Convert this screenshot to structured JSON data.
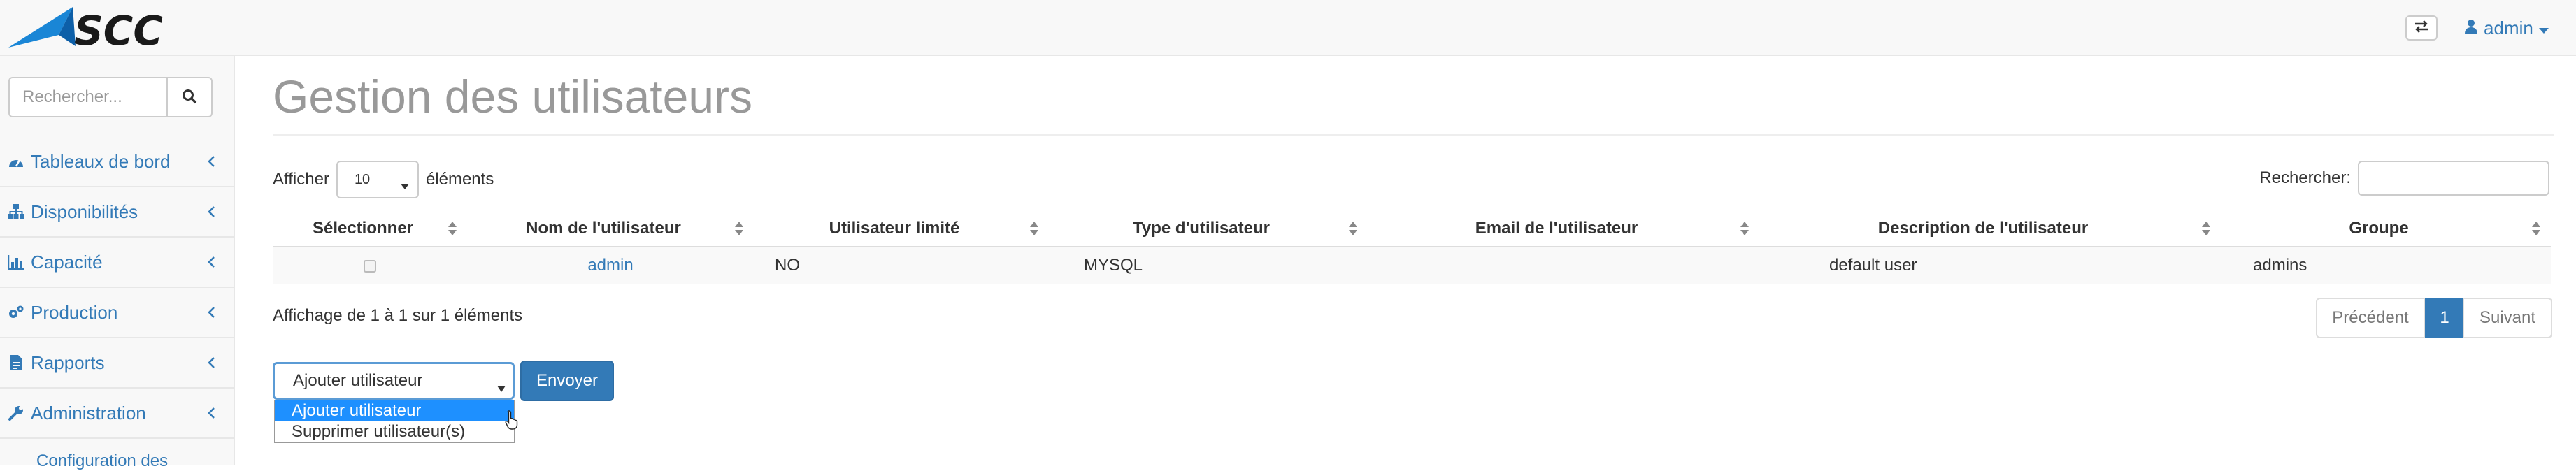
{
  "header": {
    "logo_text": "SCC",
    "user_label": "admin",
    "icons": [
      "swap-icon",
      "user-icon",
      "caret-down-icon"
    ]
  },
  "sidebar": {
    "search_placeholder": "Rechercher...",
    "items": [
      {
        "label": "Tableaux de bord",
        "icon": "dashboard-icon"
      },
      {
        "label": "Disponibilités",
        "icon": "sitemap-icon"
      },
      {
        "label": "Capacité",
        "icon": "bar-chart-icon"
      },
      {
        "label": "Production",
        "icon": "cogs-icon"
      },
      {
        "label": "Rapports",
        "icon": "file-icon"
      },
      {
        "label": "Administration",
        "icon": "wrench-icon"
      }
    ],
    "sub_item": "Configuration des"
  },
  "main": {
    "title": "Gestion des utilisateurs",
    "length_prefix": "Afficher",
    "length_value": "10",
    "length_suffix": "éléments",
    "search_label": "Rechercher:",
    "columns": [
      "Sélectionner",
      "Nom de l'utilisateur",
      "Utilisateur limité",
      "Type d'utilisateur",
      "Email de l'utilisateur",
      "Description de l'utilisateur",
      "Groupe"
    ],
    "rows": [
      {
        "name": "admin",
        "limited": "NO",
        "type": "MYSQL",
        "email": "",
        "description": "default user",
        "group": "admins"
      }
    ],
    "info": "Affichage de 1 à 1 sur 1 éléments",
    "pager": {
      "prev": "Précédent",
      "current": "1",
      "next": "Suivant"
    },
    "action": {
      "selected": "Ajouter utilisateur",
      "options": [
        "Ajouter utilisateur",
        "Supprimer utilisateur(s)"
      ],
      "submit": "Envoyer"
    }
  },
  "colors": {
    "accent": "#337ab7",
    "title_gray": "#999999",
    "option_highlight": "#1e90ff"
  }
}
